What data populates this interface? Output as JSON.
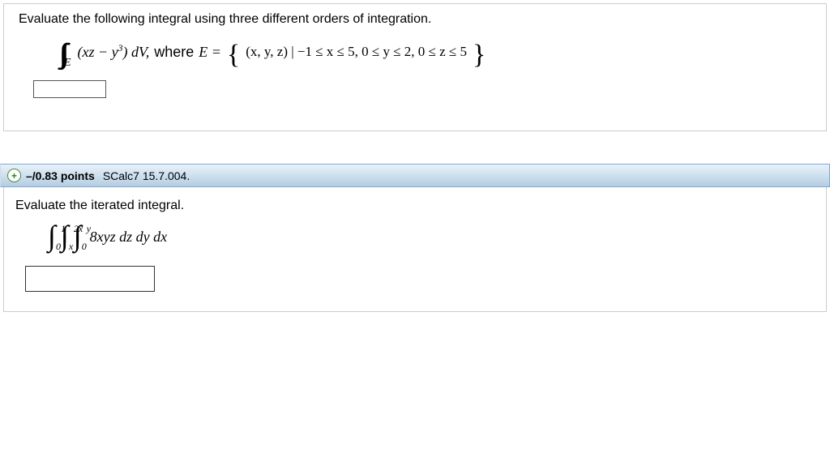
{
  "q1": {
    "prompt": "Evaluate the following integral using three different orders of integration.",
    "triple_int": "∫∫∫",
    "sub": "E",
    "integrand_html": "(xz − y³) dV,",
    "where": "where",
    "evar": "E =",
    "set_open": "{",
    "set_body": "(x, y, z) |  −1 ≤ x ≤ 5, 0 ≤ y ≤ 2, 0 ≤ z ≤ 5",
    "set_close": "}"
  },
  "q2": {
    "header": {
      "score": "–/0.83 points",
      "ref": "SCalc7 15.7.004."
    },
    "prompt": "Evaluate the iterated integral.",
    "limits": {
      "a_lo": "0",
      "a_up": "1",
      "b_lo": "x",
      "b_up": "2x",
      "c_lo": "0",
      "c_up": "y"
    },
    "integrand": "8xyz dz dy dx"
  }
}
